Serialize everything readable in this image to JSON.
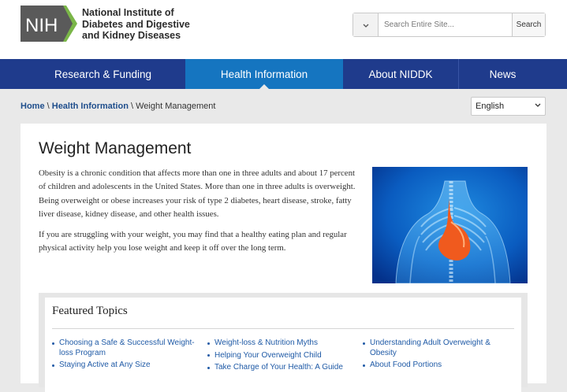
{
  "header": {
    "logo_mark": "NIH",
    "org_name_lines": [
      "National Institute of",
      "Diabetes and Digestive",
      "and Kidney Diseases"
    ],
    "search": {
      "placeholder": "Search Entire Site...",
      "button_label": "Search"
    }
  },
  "nav": {
    "items": [
      {
        "label": "Research & Funding"
      },
      {
        "label": "Health Information"
      },
      {
        "label": "About NIDDK"
      },
      {
        "label": "News"
      }
    ],
    "active_index": 1
  },
  "breadcrumb": {
    "home": "Home",
    "sep": "\\",
    "section": "Health Information",
    "current": "Weight Management"
  },
  "language": {
    "selected": "English"
  },
  "main": {
    "title": "Weight Management",
    "paragraphs": [
      "Obesity is a chronic condition that affects more than one in three adults and about 17 percent of children and adolescents in the United States. More than one in three adults is overweight. Being overweight or obese increases your risk of type 2 diabetes, heart disease, stroke, fatty liver disease, kidney disease, and other health issues.",
      "If you are struggling with your weight, you may find that a healthy eating plan and regular physical activity help you lose weight and keep it off over the long term."
    ]
  },
  "featured": {
    "title": "Featured Topics",
    "columns": [
      [
        "Choosing a Safe & Successful Weight-loss Program",
        "Staying Active at Any Size"
      ],
      [
        "Weight-loss & Nutrition Myths",
        "Helping Your Overweight Child",
        "Take Charge of Your Health: A Guide"
      ],
      [
        "Understanding Adult Overweight & Obesity",
        "About Food Portions"
      ]
    ]
  },
  "colors": {
    "nav_bg": "#1f3b8c",
    "nav_active": "#1575c0",
    "link": "#1f5aa6",
    "logo_green": "#7ab648",
    "logo_gray": "#5a5a5a"
  }
}
